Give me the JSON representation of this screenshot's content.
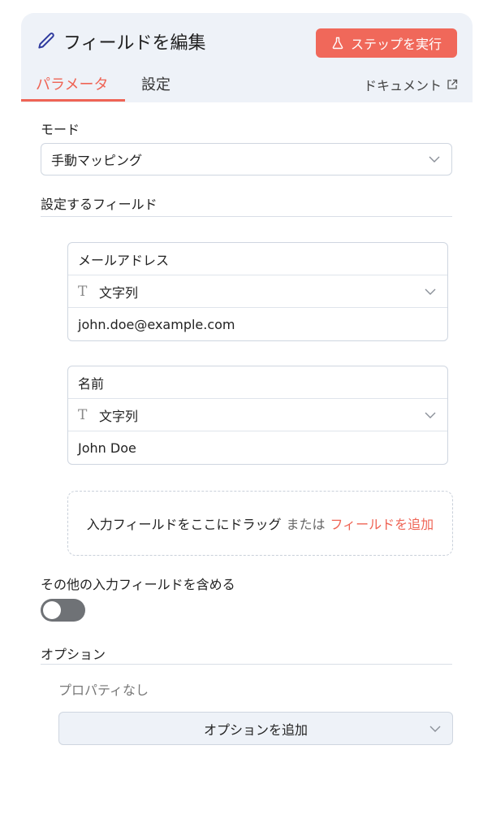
{
  "header": {
    "title": "フィールドを編集",
    "run_button": "ステップを実行",
    "tabs": [
      {
        "label": "パラメータ",
        "active": true
      },
      {
        "label": "設定",
        "active": false
      }
    ],
    "docs_link": "ドキュメント"
  },
  "mode": {
    "label": "モード",
    "value": "手動マッピング"
  },
  "fields_section": {
    "label": "設定するフィールド",
    "fields": [
      {
        "name": "メールアドレス",
        "type": "文字列",
        "value": "john.doe@example.com"
      },
      {
        "name": "名前",
        "type": "文字列",
        "value": "John Doe"
      }
    ]
  },
  "dropzone": {
    "text": "入力フィールドをここにドラッグ",
    "or": "または",
    "add_link": "フィールドを追加"
  },
  "include_others": {
    "label": "その他の入力フィールドを含める",
    "enabled": false
  },
  "options": {
    "label": "オプション",
    "empty_text": "プロパティなし",
    "add_button": "オプションを追加"
  },
  "colors": {
    "accent": "#ef6455",
    "header_bg": "#eef2f8",
    "toggle_off": "#6f7276"
  },
  "icons": [
    "pencil-icon",
    "flask-icon",
    "external-link-icon",
    "chevron-down-icon",
    "text-type-icon"
  ]
}
